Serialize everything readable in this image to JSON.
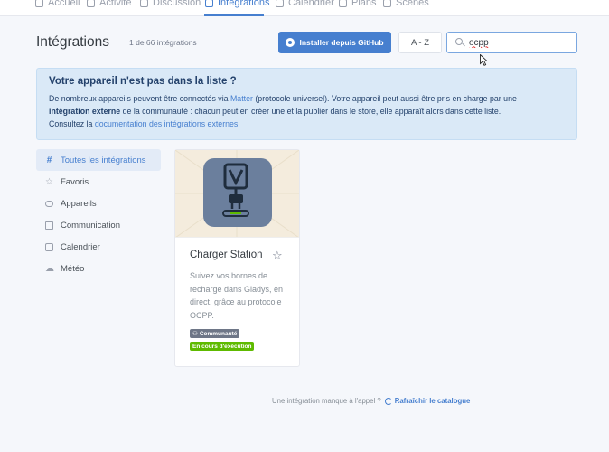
{
  "topnav": {
    "items": [
      {
        "label": "Accueil",
        "icon": "home-icon"
      },
      {
        "label": "Activité",
        "icon": "activity-icon"
      },
      {
        "label": "Discussion",
        "icon": "chat-icon"
      },
      {
        "label": "Intégrations",
        "icon": "grid-icon",
        "active": true
      },
      {
        "label": "Calendrier",
        "icon": "calendar-icon"
      },
      {
        "label": "Plans",
        "icon": "map-icon"
      },
      {
        "label": "Scènes",
        "icon": "play-icon"
      }
    ]
  },
  "header": {
    "title": "Intégrations",
    "count": "1 de 66 intégrations",
    "github_button": "Installer depuis GitHub",
    "sort_button": "A - Z",
    "search_value": "ocpp"
  },
  "alert": {
    "title": "Votre appareil n'est pas dans la liste ?",
    "line1_a": "De nombreux appareils peuvent être connectés via ",
    "line1_link": "Matter",
    "line1_b": " (protocole universel). Votre appareil peut aussi être pris en charge par une",
    "line2_bold": "intégration externe",
    "line2_rest": " de la communauté : chacun peut en créer une et la publier dans le store, elle apparaît alors dans cette liste.",
    "line3_a": "Consultez la ",
    "line3_link": "documentation des intégrations externes",
    "line3_b": "."
  },
  "sidebar": {
    "items": [
      {
        "label": "Toutes les intégrations",
        "icon": "hash-icon",
        "active": true
      },
      {
        "label": "Favoris",
        "icon": "star-icon"
      },
      {
        "label": "Appareils",
        "icon": "toggle-icon"
      },
      {
        "label": "Communication",
        "icon": "message-icon"
      },
      {
        "label": "Calendrier",
        "icon": "calendar-icon"
      },
      {
        "label": "Météo",
        "icon": "cloud-icon"
      }
    ]
  },
  "card": {
    "title": "Charger Station",
    "description": "Suivez vos bornes de recharge dans Gladys, en direct, grâce au protocole OCPP.",
    "badge_community": "Communauté",
    "badge_status": "En cours d'exécution"
  },
  "footer": {
    "text": "Une intégration manque à l'appel ?",
    "refresh": "Rafraîchir le catalogue"
  },
  "colors": {
    "primary": "#467fcf",
    "alert_bg": "#dae9f7",
    "success": "#5eba00",
    "badge_gray": "#6e7687",
    "card_bg": "#f4ecdd"
  }
}
